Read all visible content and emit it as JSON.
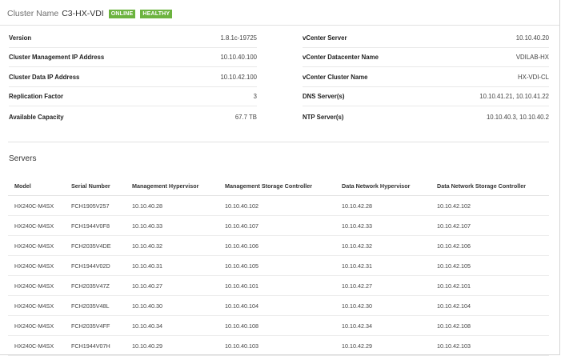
{
  "cluster": {
    "label": "Cluster Name",
    "name": "C3-HX-VDI",
    "status_badge": "ONLINE",
    "health_badge": "HEALTHY",
    "badge_color": "#6cb33f"
  },
  "summary_left": [
    {
      "label": "Version",
      "value": "1.8.1c-19725"
    },
    {
      "label": "Cluster Management IP Address",
      "value": "10.10.40.100"
    },
    {
      "label": "Cluster Data IP Address",
      "value": "10.10.42.100"
    },
    {
      "label": "Replication Factor",
      "value": "3"
    },
    {
      "label": "Available Capacity",
      "value": "67.7 TB"
    }
  ],
  "summary_right": [
    {
      "label": "vCenter Server",
      "value": "10.10.40.20"
    },
    {
      "label": "vCenter Datacenter Name",
      "value": "VDILAB-HX"
    },
    {
      "label": "vCenter Cluster Name",
      "value": "HX-VDI-CL"
    },
    {
      "label": "DNS Server(s)",
      "value": "10.10.41.21, 10.10.41.22"
    },
    {
      "label": "NTP Server(s)",
      "value": "10.10.40.3, 10.10.40.2"
    }
  ],
  "servers": {
    "title": "Servers",
    "columns": [
      "Model",
      "Serial Number",
      "Management Hypervisor",
      "Management Storage Controller",
      "Data Network Hypervisor",
      "Data Network Storage Controller"
    ],
    "rows": [
      [
        "HX240C-M4SX",
        "FCH1905V257",
        "10.10.40.28",
        "10.10.40.102",
        "10.10.42.28",
        "10.10.42.102"
      ],
      [
        "HX240C-M4SX",
        "FCH1944V0F8",
        "10.10.40.33",
        "10.10.40.107",
        "10.10.42.33",
        "10.10.42.107"
      ],
      [
        "HX240C-M4SX",
        "FCH2035V4DE",
        "10.10.40.32",
        "10.10.40.106",
        "10.10.42.32",
        "10.10.42.106"
      ],
      [
        "HX240C-M4SX",
        "FCH1944V02D",
        "10.10.40.31",
        "10.10.40.105",
        "10.10.42.31",
        "10.10.42.105"
      ],
      [
        "HX240C-M4SX",
        "FCH2035V47Z",
        "10.10.40.27",
        "10.10.40.101",
        "10.10.42.27",
        "10.10.42.101"
      ],
      [
        "HX240C-M4SX",
        "FCH2035V48L",
        "10.10.40.30",
        "10.10.40.104",
        "10.10.42.30",
        "10.10.42.104"
      ],
      [
        "HX240C-M4SX",
        "FCH2035V4FF",
        "10.10.40.34",
        "10.10.40.108",
        "10.10.42.34",
        "10.10.42.108"
      ],
      [
        "HX240C-M4SX",
        "FCH1944V07H",
        "10.10.40.29",
        "10.10.40.103",
        "10.10.42.29",
        "10.10.42.103"
      ]
    ]
  }
}
